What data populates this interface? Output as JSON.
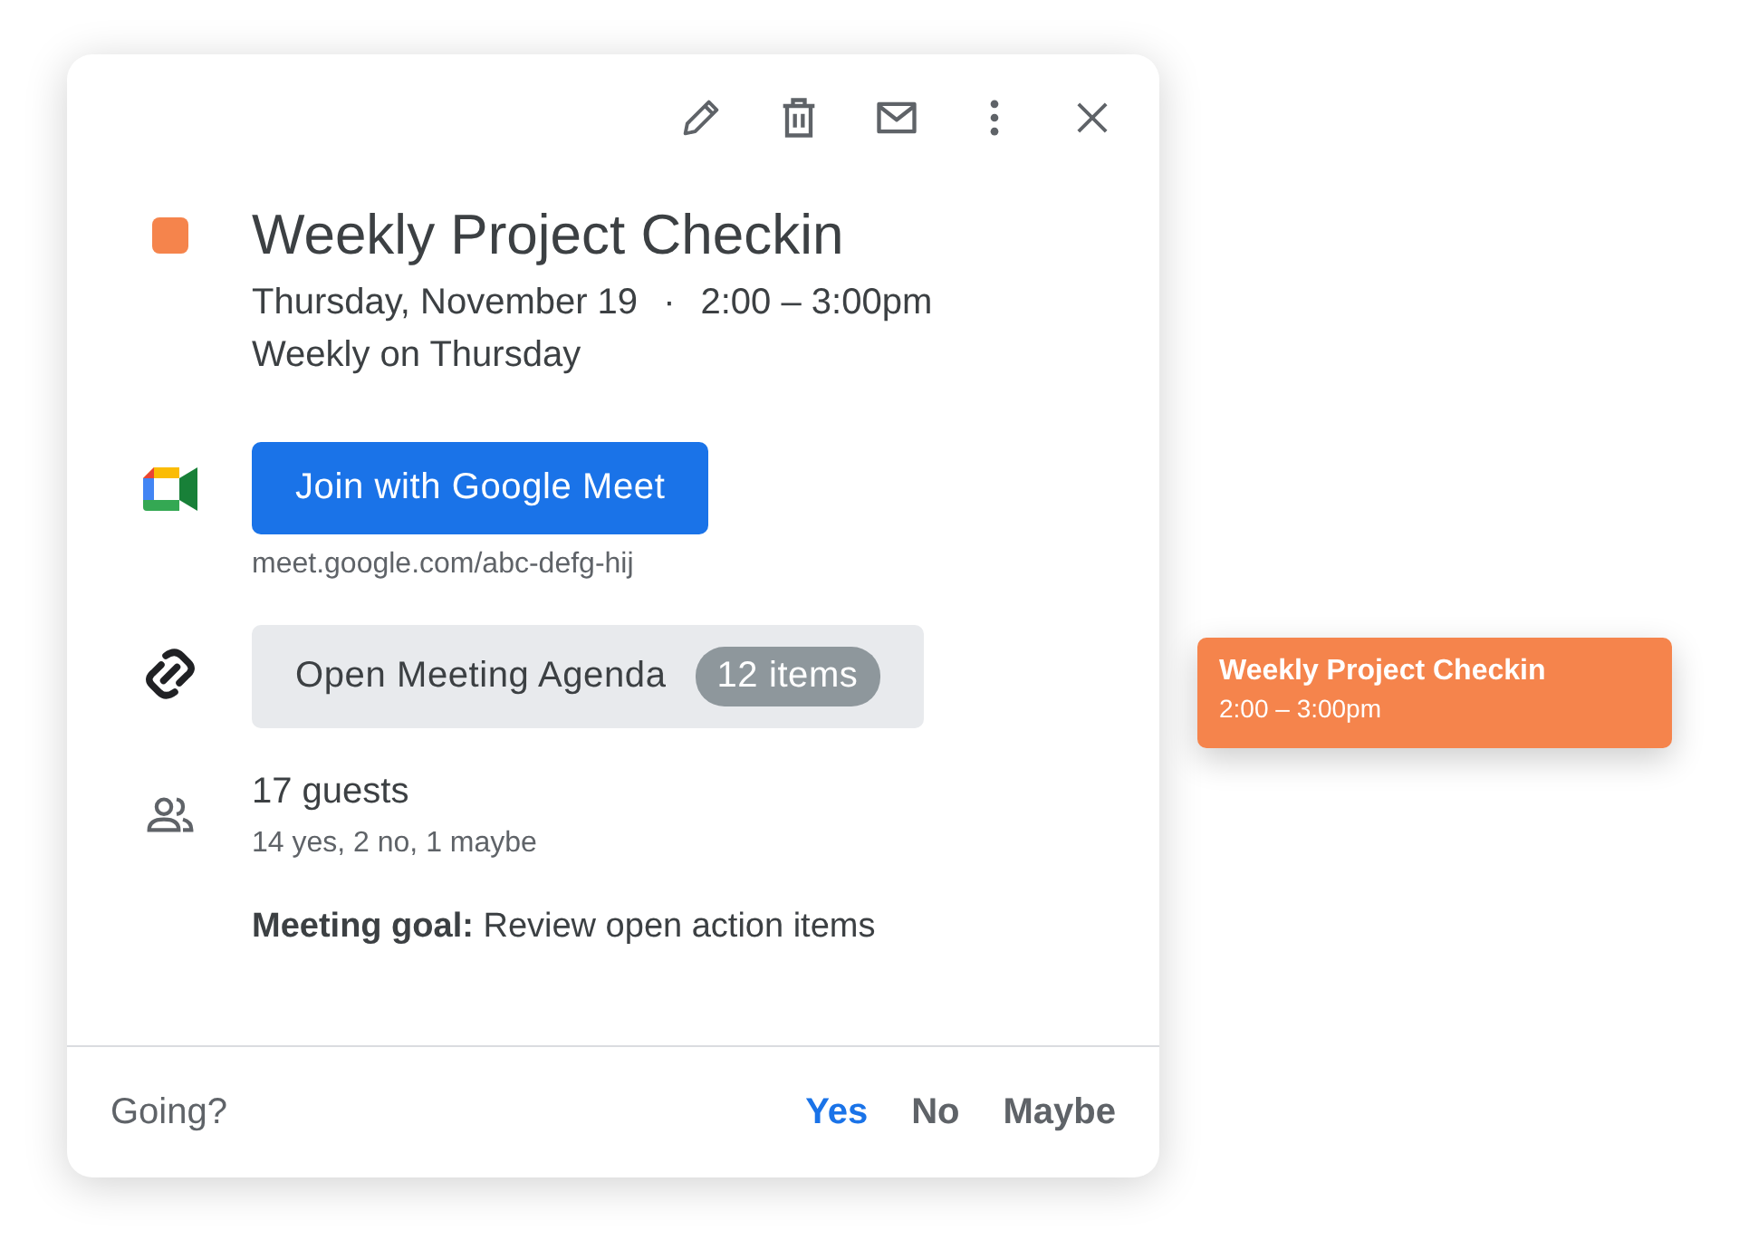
{
  "event": {
    "color": "#f5844c",
    "title": "Weekly Project Checkin",
    "date": "Thursday, November 19",
    "separator": "·",
    "time": "2:00 – 3:00pm",
    "recurrence": "Weekly on Thursday"
  },
  "meet": {
    "button": "Join with Google Meet",
    "link": "meet.google.com/abc-defg-hij"
  },
  "agenda": {
    "label": "Open Meeting Agenda",
    "badge": "12 items"
  },
  "guests": {
    "count": "17 guests",
    "summary": "14 yes, 2 no, 1 maybe"
  },
  "description": "**Meeting goal:** Review open action items",
  "rsvp": {
    "prompt": "Going?",
    "options": [
      {
        "label": "Yes",
        "selected": true
      },
      {
        "label": "No",
        "selected": false
      },
      {
        "label": "Maybe",
        "selected": false
      }
    ]
  },
  "calendar_chip": {
    "title": "Weekly Project Checkin",
    "time": "2:00 – 3:00pm",
    "color": "#f5844c"
  }
}
